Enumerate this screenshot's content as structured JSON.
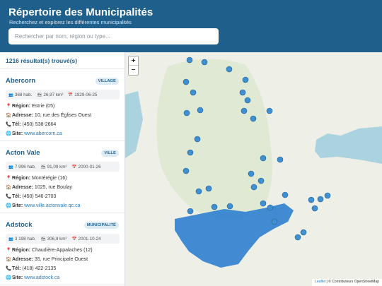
{
  "header": {
    "title": "Répertoire des Municipalités",
    "subtitle": "Recherchez et explorez les différentes municipalités",
    "search_placeholder": "Rechercher par nom, région ou type..."
  },
  "results": {
    "count": "1216 résultat(s) trouvé(s)"
  },
  "municipalities": [
    {
      "name": "Abercorn",
      "type": "VILLAGE",
      "population": "368 hab.",
      "area": "26,97 km²",
      "date": "1929-06-25",
      "region_label": "Région:",
      "region": "Estrie (05)",
      "address_label": "Adresse:",
      "address": "10, rue des Églises Ouest",
      "phone_label": "Tél:",
      "phone": "(450) 538-2664",
      "site_label": "Site:",
      "site": "www.abercorn.ca"
    },
    {
      "name": "Acton Vale",
      "type": "VILLE",
      "population": "7 996 hab.",
      "area": "91,09 km²",
      "date": "2000-01-26",
      "region_label": "Région:",
      "region": "Montérégie (16)",
      "address_label": "Adresse:",
      "address": "1025, rue Boulay",
      "phone_label": "Tél:",
      "phone": "(450) 546-2703",
      "site_label": "Site:",
      "site": "www.ville.actonvale.qc.ca"
    },
    {
      "name": "Adstock",
      "type": "MUNICIPALITÉ",
      "population": "3 198 hab.",
      "area": "306,9 km²",
      "date": "2001-10-24",
      "region_label": "Région:",
      "region": "Chaudière-Appalaches (12)",
      "address_label": "Adresse:",
      "address": "35, rue Principale Ouest",
      "phone_label": "Tél:",
      "phone": "(418) 422-2135",
      "site_label": "Site:",
      "site": "www.adstock.ca"
    }
  ],
  "map": {
    "zoom_in": "+",
    "zoom_out": "−",
    "attribution_leaflet": "Leaflet",
    "attribution_osm": "| © Contributeurs OpenStreetMap",
    "colors": {
      "marker": "#3f8fd3",
      "cluster": "#2f7fd0",
      "land": "#eef0e8",
      "water": "#aad3df"
    }
  },
  "icons": {
    "population": "people-icon",
    "area": "map-icon",
    "date": "calendar-icon",
    "region": "pin-icon",
    "address": "house-icon",
    "phone": "phone-icon",
    "site": "globe-icon"
  }
}
